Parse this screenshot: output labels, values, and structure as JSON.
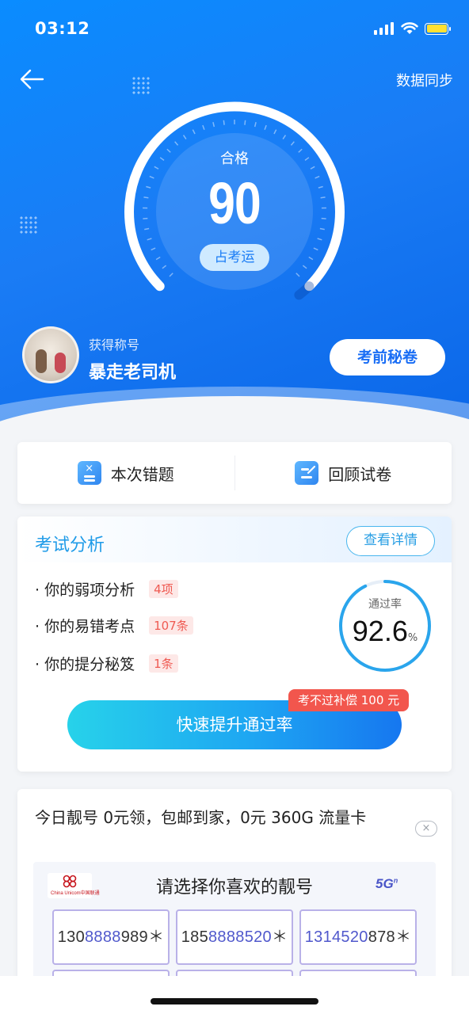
{
  "status_bar": {
    "time": "03:12"
  },
  "header": {
    "sync_label": "数据同步"
  },
  "score_gauge": {
    "status": "合格",
    "score": "90",
    "fortune_label": "占考运"
  },
  "user": {
    "title_label": "获得称号",
    "title_name": "暴走老司机",
    "secret_button": "考前秘卷"
  },
  "quick_actions": [
    {
      "label": "本次错题"
    },
    {
      "label": "回顾试卷"
    }
  ],
  "analysis": {
    "title": "考试分析",
    "detail_button": "查看详情",
    "items": [
      {
        "label": "· 你的弱项分析",
        "tag": "4项"
      },
      {
        "label": "· 你的易错考点",
        "tag": "107条"
      },
      {
        "label": "· 你的提分秘笈",
        "tag": "1条"
      }
    ],
    "pass_rate_label": "通过率",
    "pass_rate_value": "92.6",
    "pass_rate_unit": "%",
    "pass_rate_fraction": 0.926,
    "boost_button": "快速提升通过率",
    "compensation_badge": "考不过补偿 100 元"
  },
  "promo": {
    "title": "今日靓号 0元领，包邮到家，0元 360G 流量卡",
    "close_icon": "×",
    "choose_text": "请选择你喜欢的靓号",
    "carrier_text": "China Unicom中国联通",
    "network_badge": "5G",
    "network_badge_sup": "n",
    "numbers": [
      {
        "prefix": "130",
        "highlight": "8888",
        "suffix": "989＊"
      },
      {
        "prefix": "185",
        "highlight": "8888520",
        "suffix": "＊"
      },
      {
        "prefix": "",
        "highlight": "1314520",
        "suffix": "878＊"
      }
    ]
  },
  "colors": {
    "primary_blue": "#1a7cf5",
    "accent_cyan": "#1f9be8",
    "tag_red": "#ef5a52",
    "badge_red": "#f2564d",
    "unicom_purple": "#5058cc"
  }
}
